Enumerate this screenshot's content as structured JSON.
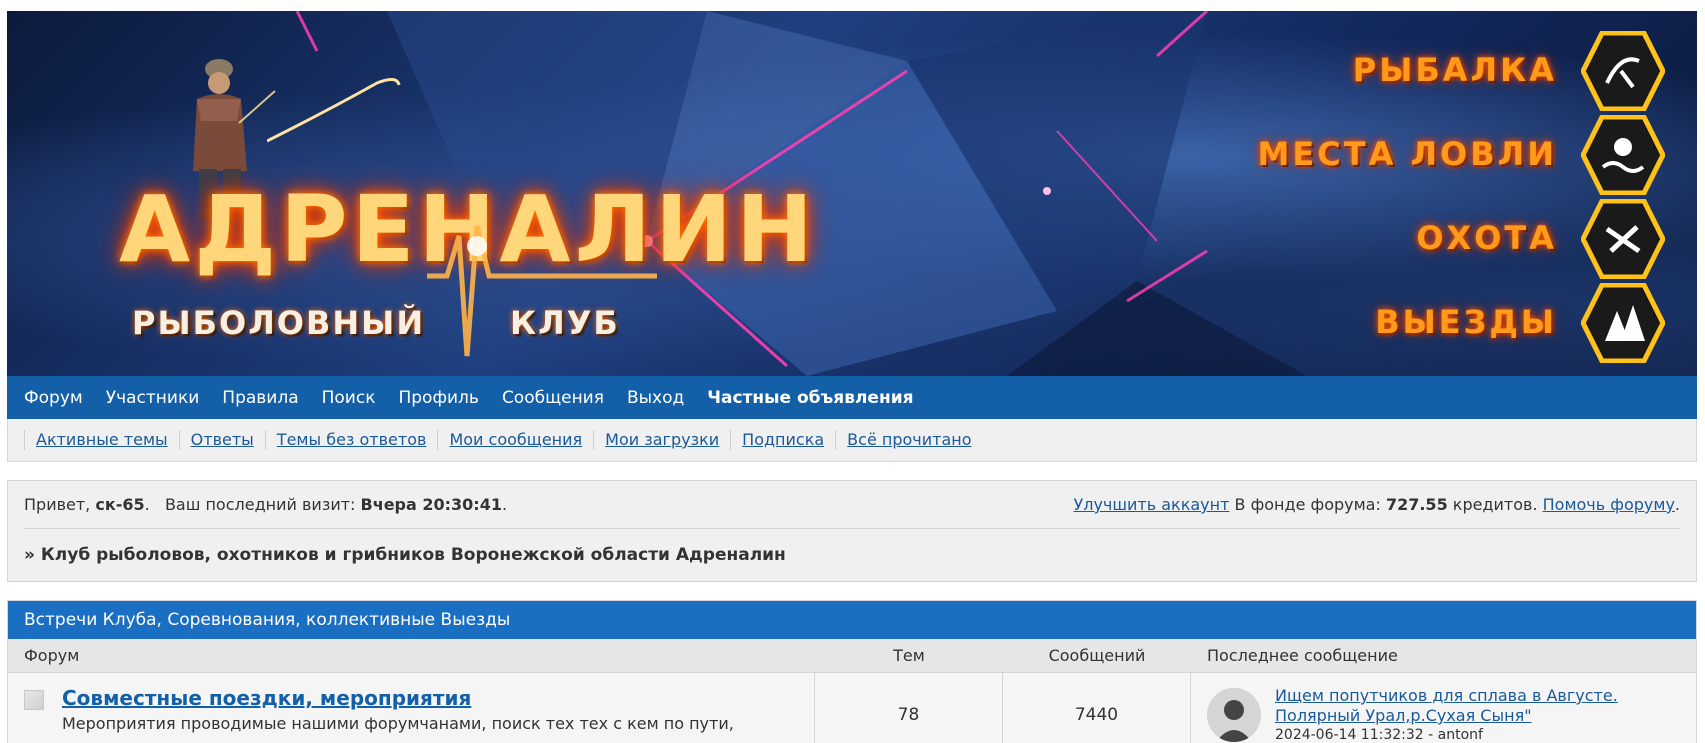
{
  "banner": {
    "logo_main": "АДРЕНАЛИН",
    "logo_sub_left": "РЫБОЛОВНЫЙ",
    "logo_sub_right": "КЛУБ",
    "nav": [
      {
        "label": "РЫБАЛКА",
        "icon": "fishing-icon"
      },
      {
        "label": "МЕСТА ЛОВЛИ",
        "icon": "fish-spot-icon"
      },
      {
        "label": "ОХОТА",
        "icon": "hunting-icon"
      },
      {
        "label": "ВЫЕЗДЫ",
        "icon": "trips-icon"
      }
    ]
  },
  "mainnav": [
    "Форум",
    "Участники",
    "Правила",
    "Поиск",
    "Профиль",
    "Сообщения",
    "Выход",
    "Частные объявления"
  ],
  "subnav": [
    "Активные темы",
    "Ответы",
    "Темы без ответов",
    "Мои сообщения",
    "Мои загрузки",
    "Подписка",
    "Всё прочитано"
  ],
  "welcome": {
    "greeting": "Привет, ",
    "username": "ск-65",
    "last_visit_label": ".   Ваш последний визит: ",
    "last_visit": "Вчера 20:30:41",
    "period": ".",
    "upgrade_link": "Улучшить аккаунт",
    "fund_label": " В фонде форума: ",
    "fund_amount": "727.55",
    "credits_label": " кредитов. ",
    "help_link": "Помочь форуму",
    "help_period": ".",
    "breadcrumb": "» Клуб рыболовов, охотников и грибников Воронежской области Адреналин"
  },
  "category": {
    "title": "Встречи Клуба, Соревнования, коллективные Выезды",
    "columns": {
      "forum": "Форум",
      "topics": "Тем",
      "posts": "Сообщений",
      "last": "Последнее сообщение"
    },
    "rows": [
      {
        "title": "Совместные поездки, мероприятия",
        "description": "Мероприятия проводимые нашими форумчанами, поиск тех тех с кем по пути,",
        "topics": "78",
        "posts": "7440",
        "last_line1": "Ищем попутчиков для сплава в Августе.",
        "last_line2": "Полярный Урал,р.Сухая Сыня\"",
        "last_meta": "2024-06-14 11:32:32 - antonf"
      }
    ]
  },
  "colors": {
    "nav_bg": "#1360a8",
    "cat_head_bg": "#1a6fc2",
    "link": "#1a5a9a",
    "accent_orange": "#ff9a1a"
  }
}
